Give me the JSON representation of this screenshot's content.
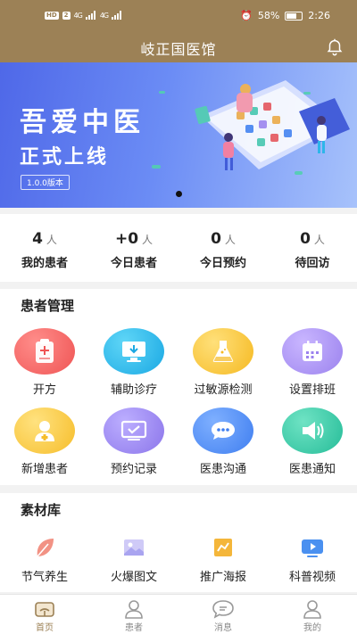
{
  "status_bar": {
    "chips": [
      "HD",
      "2"
    ],
    "signal_1": "4G",
    "signal_2": "4G",
    "battery": "58%",
    "time": "2:26"
  },
  "header": {
    "title": "岐正国医馆",
    "notification_icon": "bell-icon"
  },
  "banner": {
    "headline": "吾爱中医",
    "subline": "正式上线",
    "version": "1.0.0版本",
    "colors": {
      "from": "#4f68e8",
      "to": "#a7c2fb"
    }
  },
  "stats": [
    {
      "value": "4",
      "unit": "人",
      "label": "我的患者"
    },
    {
      "value": "+0",
      "unit": "人",
      "label": "今日患者"
    },
    {
      "value": "0",
      "unit": "人",
      "label": "今日预约"
    },
    {
      "value": "0",
      "unit": "人",
      "label": "待回访"
    }
  ],
  "patient_management": {
    "title": "患者管理",
    "items": [
      {
        "label": "开方",
        "icon": "prescription-icon",
        "color": "#f0605f"
      },
      {
        "label": "辅助诊疗",
        "icon": "monitor-download-icon",
        "color": "#23b6e8"
      },
      {
        "label": "过敏源检测",
        "icon": "flask-icon",
        "color": "#f7c531"
      },
      {
        "label": "设置排班",
        "icon": "calendar-icon",
        "color": "#a88ef0"
      },
      {
        "label": "新增患者",
        "icon": "add-user-icon",
        "color": "#f9c83b"
      },
      {
        "label": "预约记录",
        "icon": "screen-check-icon",
        "color": "#9a86ee"
      },
      {
        "label": "医患沟通",
        "icon": "chat-bubble-icon",
        "color": "#4d8cf3"
      },
      {
        "label": "医患通知",
        "icon": "speaker-icon",
        "color": "#35c8a6"
      }
    ]
  },
  "material_library": {
    "title": "素材库",
    "items": [
      {
        "label": "节气养生",
        "icon": "leaf-icon",
        "color": "#f07f6e"
      },
      {
        "label": "火爆图文",
        "icon": "image-icon",
        "color": "#a9a4f0"
      },
      {
        "label": "推广海报",
        "icon": "poster-icon",
        "color": "#f4b63a"
      },
      {
        "label": "科普视频",
        "icon": "video-icon",
        "color": "#4a90f0"
      }
    ]
  },
  "bottom_nav": {
    "items": [
      {
        "label": "首页",
        "icon": "home-icon",
        "active": true
      },
      {
        "label": "患者",
        "icon": "patient-icon",
        "active": false
      },
      {
        "label": "消息",
        "icon": "message-icon",
        "active": false
      },
      {
        "label": "我的",
        "icon": "profile-icon",
        "active": false
      }
    ],
    "active_color": "#9c8156"
  }
}
